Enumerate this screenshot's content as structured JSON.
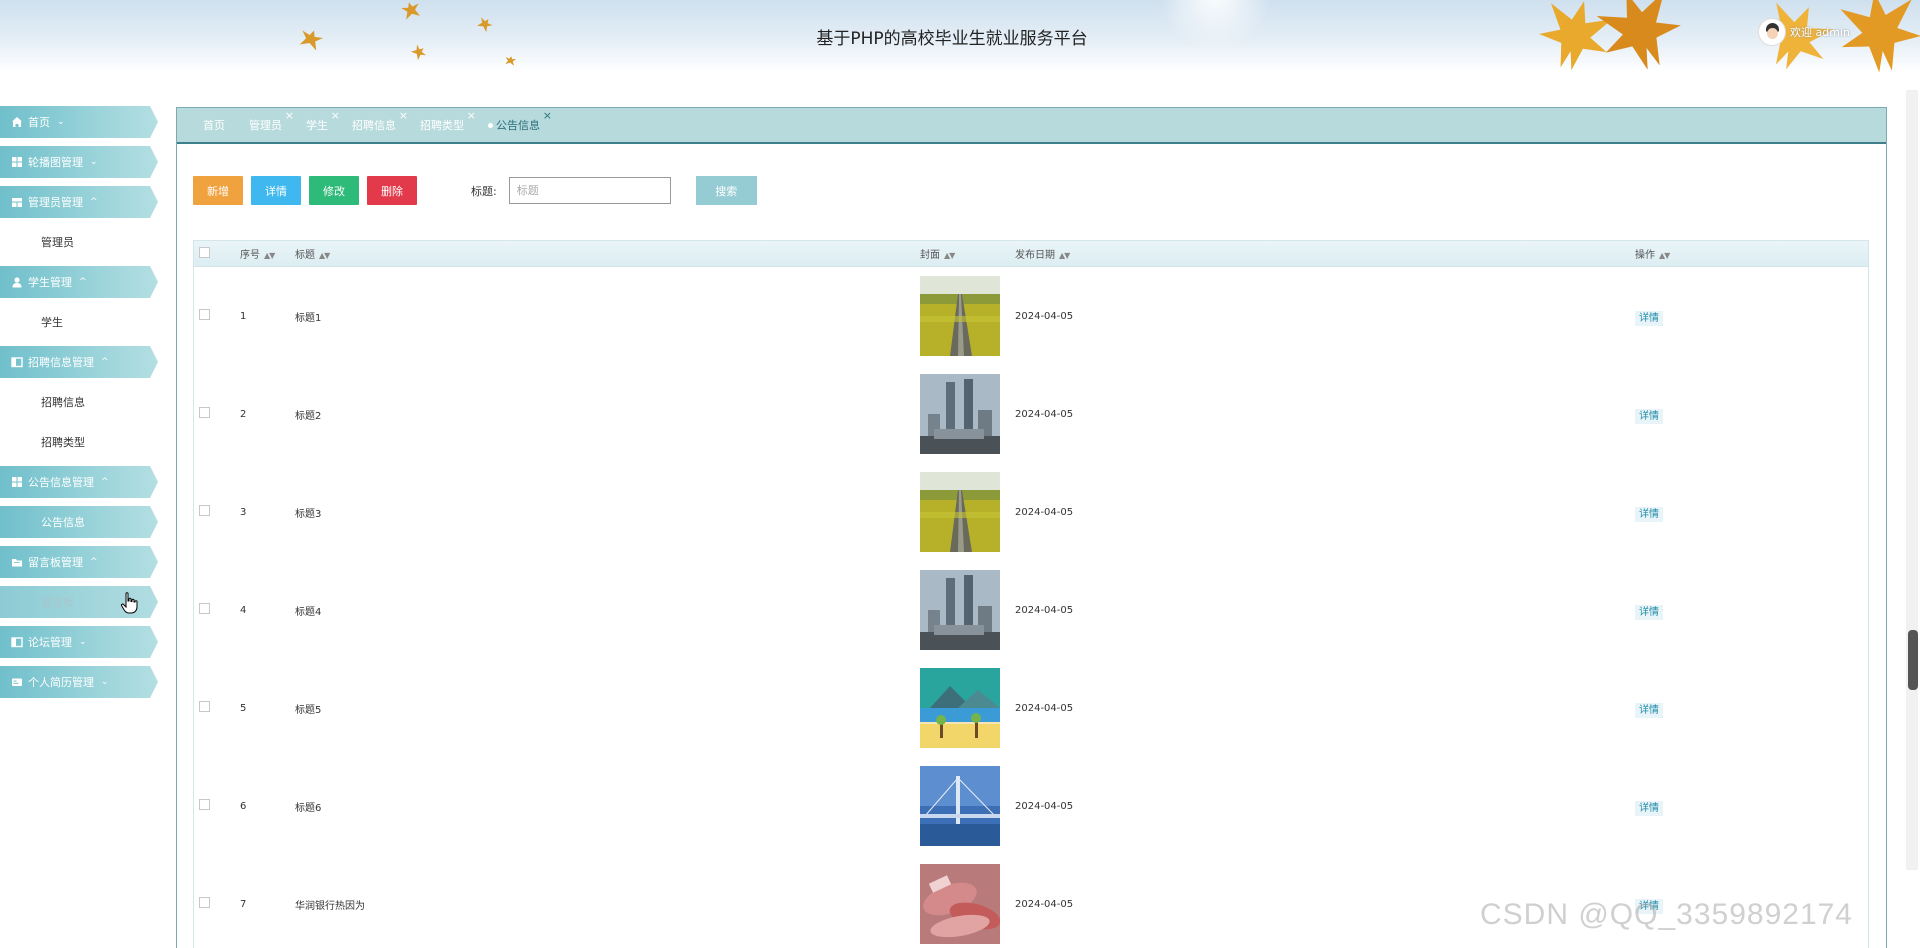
{
  "header": {
    "title": "基于PHP的高校毕业生就业服务平台",
    "welcome": "欢迎 admin"
  },
  "sidebar": {
    "items": [
      {
        "label": "首页",
        "icon": "home-icon",
        "expanded": false,
        "children": []
      },
      {
        "label": "轮播图管理",
        "icon": "grid-icon",
        "expanded": false,
        "children": []
      },
      {
        "label": "管理员管理",
        "icon": "admin-icon",
        "expanded": true,
        "children": [
          "管理员"
        ]
      },
      {
        "label": "学生管理",
        "icon": "user-icon",
        "expanded": true,
        "children": [
          "学生"
        ]
      },
      {
        "label": "招聘信息管理",
        "icon": "book-icon",
        "expanded": true,
        "children": [
          "招聘信息",
          "招聘类型"
        ]
      },
      {
        "label": "公告信息管理",
        "icon": "grid-icon",
        "expanded": true,
        "children": [
          "公告信息"
        ]
      },
      {
        "label": "留言板管理",
        "icon": "folder-icon",
        "expanded": true,
        "children": [
          "留言板"
        ]
      },
      {
        "label": "论坛管理",
        "icon": "book-icon",
        "expanded": false,
        "children": []
      },
      {
        "label": "个人简历管理",
        "icon": "card-icon",
        "expanded": false,
        "children": []
      }
    ],
    "active_child": "公告信息",
    "hover_child": "留言板"
  },
  "tabs": [
    {
      "label": "首页",
      "closable": false
    },
    {
      "label": "管理员",
      "closable": true
    },
    {
      "label": "学生",
      "closable": true
    },
    {
      "label": "招聘信息",
      "closable": true
    },
    {
      "label": "招聘类型",
      "closable": true
    },
    {
      "label": "公告信息",
      "closable": true,
      "active": true
    }
  ],
  "toolbar": {
    "add_label": "新增",
    "detail_label": "详情",
    "edit_label": "修改",
    "delete_label": "删除",
    "search_label": "标题:",
    "search_placeholder": "标题",
    "search_button": "搜索"
  },
  "table": {
    "columns": [
      "序号",
      "标题",
      "封面",
      "发布日期",
      "操作"
    ],
    "rows": [
      {
        "no": "1",
        "title": "标题1",
        "cover": "field-road",
        "date": "2024-04-05",
        "action": "详情"
      },
      {
        "no": "2",
        "title": "标题2",
        "cover": "city-towers",
        "date": "2024-04-05",
        "action": "详情"
      },
      {
        "no": "3",
        "title": "标题3",
        "cover": "field-road",
        "date": "2024-04-05",
        "action": "详情"
      },
      {
        "no": "4",
        "title": "标题4",
        "cover": "city-towers",
        "date": "2024-04-05",
        "action": "详情"
      },
      {
        "no": "5",
        "title": "标题5",
        "cover": "cartoon-landscape",
        "date": "2024-04-05",
        "action": "详情"
      },
      {
        "no": "6",
        "title": "标题6",
        "cover": "bridge-night",
        "date": "2024-04-05",
        "action": "详情"
      },
      {
        "no": "7",
        "title": "华润银行热因为",
        "cover": "money-red",
        "date": "2024-04-05",
        "action": "详情"
      }
    ]
  },
  "watermark": "CSDN @QQ_3359892174",
  "colors": {
    "menu_teal": "#6fbfcb",
    "tab_bar": "#b7dadd",
    "btn_add": "#f0a23e",
    "btn_detail": "#3fb8ef",
    "btn_edit": "#2eba79",
    "btn_delete": "#e23a4b",
    "btn_search": "#95cbd3"
  }
}
